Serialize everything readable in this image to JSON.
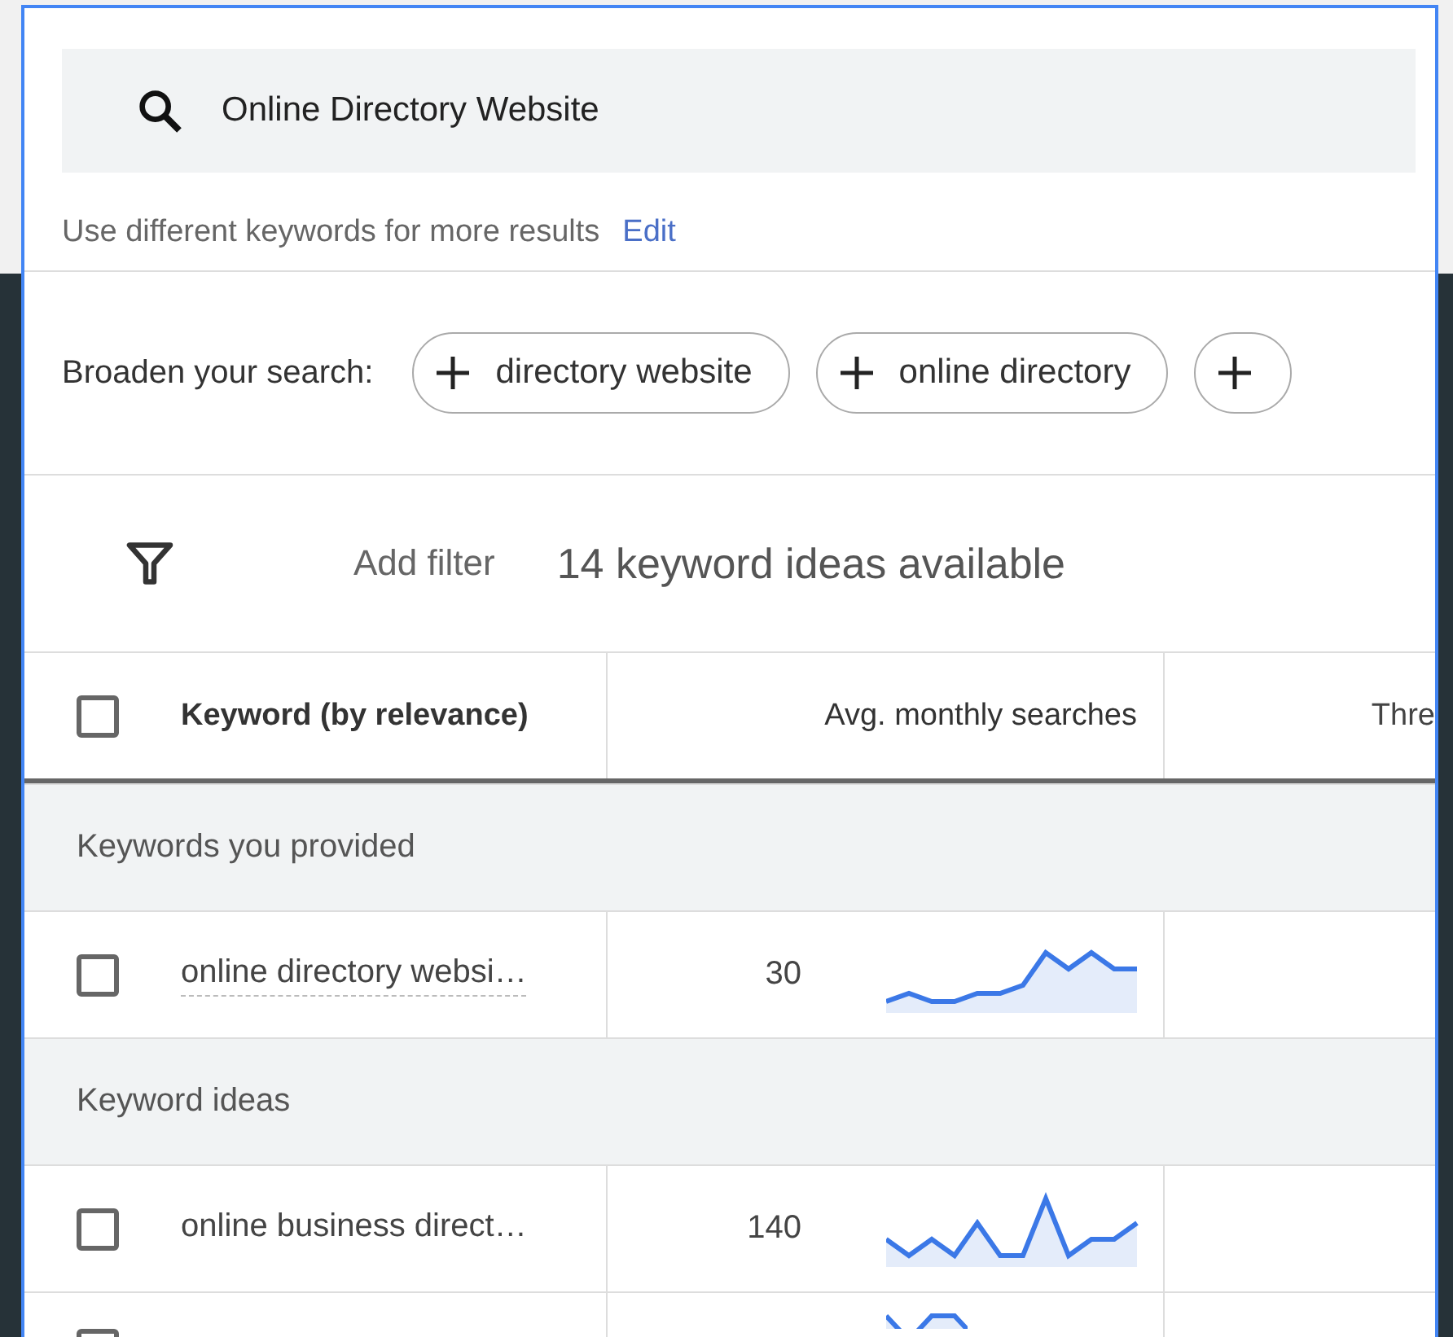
{
  "search": {
    "value": "Online Directory Website"
  },
  "hint": {
    "text": "Use different keywords for more results",
    "link": "Edit"
  },
  "broaden": {
    "label": "Broaden your search:",
    "chips": [
      {
        "kind": "chip",
        "label": "directory website"
      },
      {
        "kind": "chip",
        "label": "online directory"
      },
      {
        "kind": "partial"
      }
    ]
  },
  "filter_bar": {
    "add_filter": "Add filter",
    "count": "14 keyword ideas available"
  },
  "table": {
    "select_all": {
      "checked": false
    },
    "columns": [
      "Keyword (by relevance)",
      "Avg. monthly searches",
      "Thre"
    ],
    "rows": [
      {
        "kind": "group",
        "label": "Keywords you provided"
      },
      {
        "kind": "keyword",
        "checked": false,
        "keyword": "online directory websi…",
        "searches": "30",
        "underlined": true
      },
      {
        "kind": "group",
        "label": "Keyword ideas"
      },
      {
        "kind": "keyword",
        "checked": false,
        "keyword": "online business direct…",
        "searches": "140",
        "underlined": false
      },
      {
        "kind": "keyword",
        "checked": false
      }
    ]
  }
}
